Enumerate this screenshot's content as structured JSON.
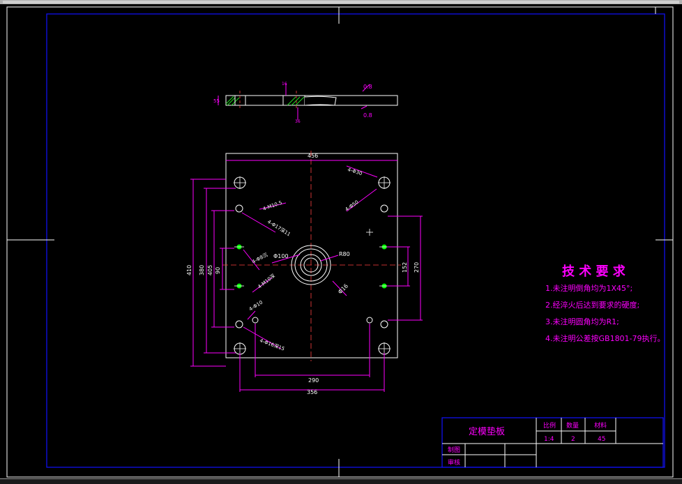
{
  "colors": {
    "background": "#000000",
    "frame": "#1010ff",
    "part": "#ffffff",
    "dimension": "#ff00ff",
    "hole_center": "#00ff00",
    "notes": "#ff00ff"
  },
  "technical_requirements": {
    "title": "技 术 要 求",
    "items": [
      "1.未注明倒角均为1X45°;",
      "2.经淬火后达到要求的硬度;",
      "3.未注明圆角均为R1;",
      "4.未注明公差按GB1801-79执行。"
    ]
  },
  "title_block": {
    "part_name": "定模垫板",
    "scale_label": "比例",
    "quantity_label": "数量",
    "material_label": "材料",
    "scale_value": "1:4",
    "quantity_value": "2",
    "material_value": "45",
    "drawn_label": "制图",
    "checked_label": "审核"
  },
  "section_view": {
    "dim_thickness": "55",
    "dim_a": "36",
    "dim_b": "16",
    "roughness_1": "0.8",
    "roughness_2": "0.8"
  },
  "plan_view": {
    "dim_width": "456",
    "dim_inner_width": "290",
    "dim_lower_width": "356",
    "dim_height_right_inner": "152",
    "dim_height_right": "270",
    "dim_left_1": "90",
    "dim_left_2": "405",
    "dim_left_3": "380",
    "dim_left_4": "410",
    "dim_center_dia": "Φ100",
    "dim_center_r": "R80",
    "dim_center_small": "Φ16",
    "note_top_holes": "4-Φ30",
    "note_top_holes_2": "4-Φ50",
    "note_screw_1": "4-M10.5",
    "note_screw_2": "4-Φ17深11",
    "note_left_1": "4-Φ8沉",
    "note_left_2": "4-M10深",
    "note_left_3": "4-Φ10",
    "note_bottom": "4-Φ16深15"
  }
}
